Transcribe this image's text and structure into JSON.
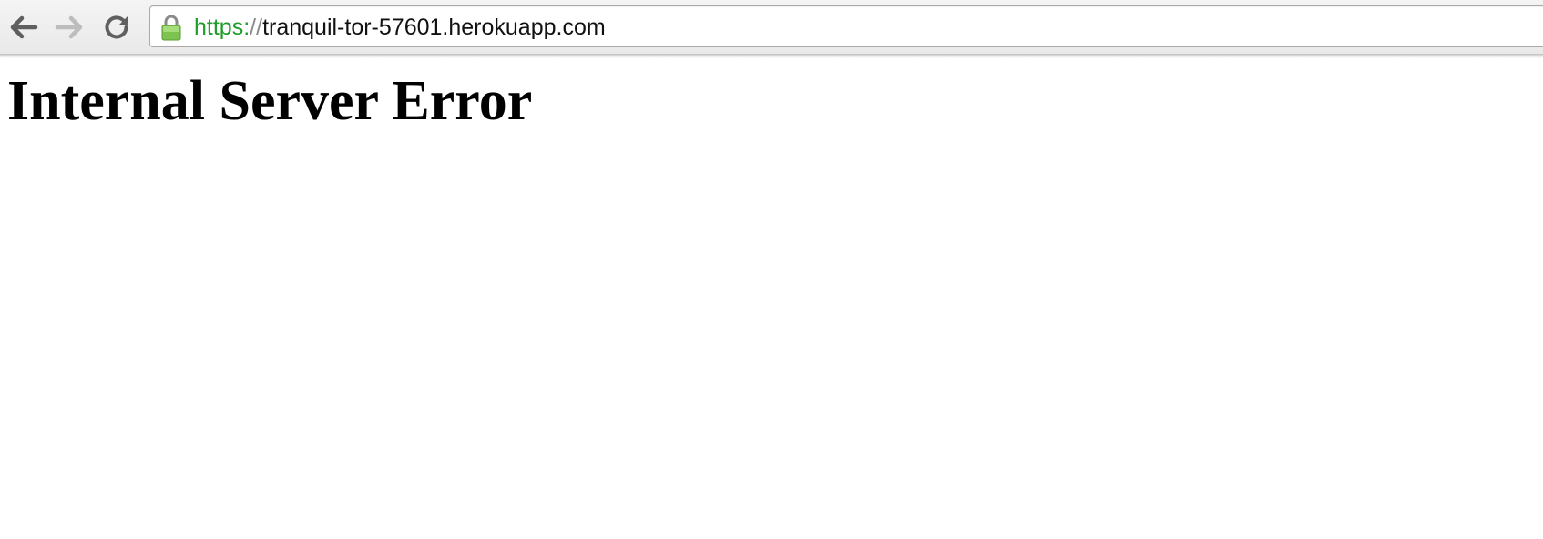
{
  "browser": {
    "toolbar": {
      "back_icon": "arrow-left-icon",
      "forward_icon": "arrow-right-icon",
      "reload_icon": "reload-icon"
    },
    "address_bar": {
      "secure_icon": "lock-icon",
      "scheme": "https:",
      "separator": "//",
      "host": "tranquil-tor-57601.herokuapp.com",
      "scheme_color": "#1f9d2b",
      "lock_color": "#7cc34f"
    }
  },
  "page": {
    "heading": "Internal Server Error"
  }
}
